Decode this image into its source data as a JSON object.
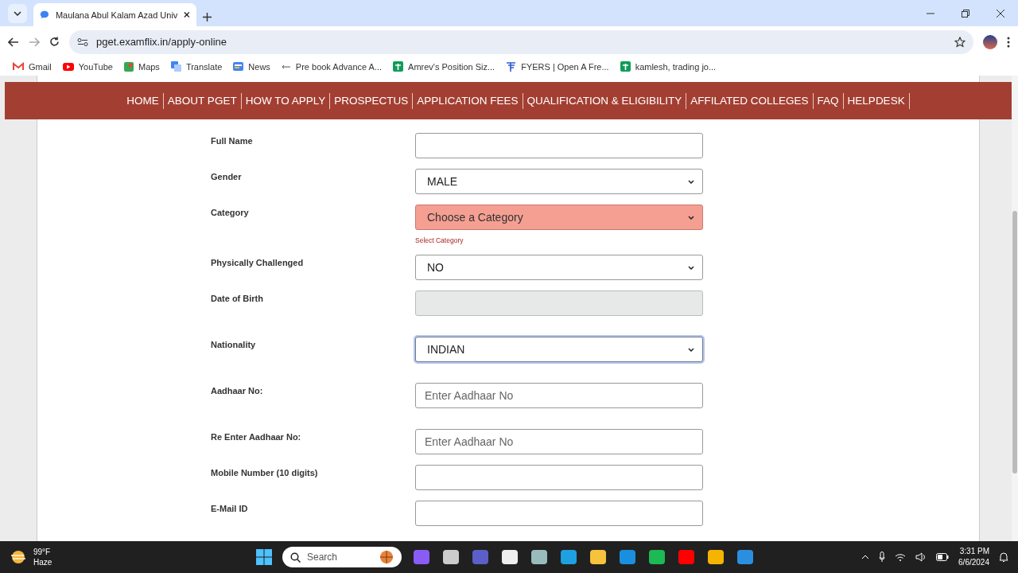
{
  "browser": {
    "tab_title": "Maulana Abul Kalam Azad Univ",
    "url": "pget.examflix.in/apply-online",
    "bookmarks": [
      {
        "label": "Gmail",
        "kind": "gmail"
      },
      {
        "label": "YouTube",
        "kind": "youtube"
      },
      {
        "label": "Maps",
        "kind": "maps"
      },
      {
        "label": "Translate",
        "kind": "translate"
      },
      {
        "label": "News",
        "kind": "news"
      },
      {
        "label": "Pre book Advance A...",
        "kind": "dash"
      },
      {
        "label": "Amrev's Position Siz...",
        "kind": "sheet"
      },
      {
        "label": "FYERS | Open A Fre...",
        "kind": "fyers"
      },
      {
        "label": "kamlesh, trading jo...",
        "kind": "sheet"
      }
    ]
  },
  "nav": [
    "HOME",
    "ABOUT PGET",
    "HOW TO APPLY",
    "PROSPECTUS",
    "APPLICATION FEES",
    "QUALIFICATION & ELIGIBILITY",
    "AFFILATED COLLEGES",
    "FAQ",
    "HELPDESK"
  ],
  "form": [
    {
      "label": "Full Name",
      "kind": "text"
    },
    {
      "label": "Gender",
      "kind": "select",
      "value": "MALE"
    },
    {
      "label": "Category",
      "kind": "select",
      "value": "Choose a Category",
      "invalid": true,
      "error": "Select Category"
    },
    {
      "label": "Physically Challenged",
      "kind": "select",
      "value": "NO"
    },
    {
      "label": "Date of Birth",
      "kind": "text",
      "disabled": true
    },
    {
      "label": "Nationality",
      "kind": "select",
      "value": "INDIAN",
      "focused": true
    },
    {
      "label": "Aadhaar No:",
      "kind": "text",
      "placeholder": "Enter Aadhaar No"
    },
    {
      "label": "Re Enter Aadhaar No:",
      "kind": "text",
      "placeholder": "Enter Aadhaar No"
    },
    {
      "label": "Mobile Number (10 digits)",
      "kind": "text"
    },
    {
      "label": "E-Mail ID",
      "kind": "text"
    }
  ],
  "taskbar": {
    "temperature": "99°F",
    "weather": "Haze",
    "search_placeholder": "Search",
    "time": "3:31 PM",
    "date": "6/6/2024"
  }
}
